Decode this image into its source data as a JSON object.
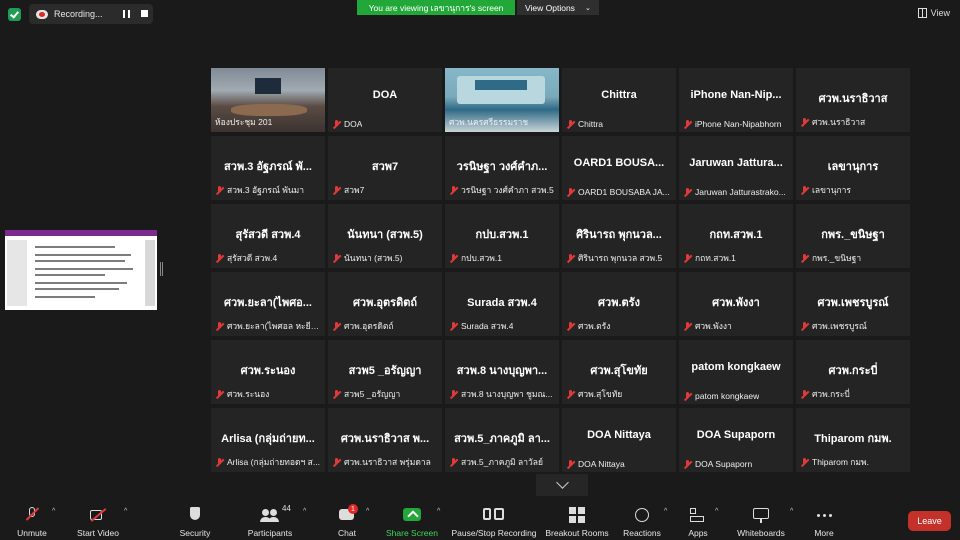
{
  "top_bar": {
    "recording_label": "Recording...",
    "viewing_banner": "You are viewing เลขานุการ's screen",
    "view_options_label": "View Options",
    "view_label": "View"
  },
  "tiles": [
    {
      "name": "",
      "label": "ห้องประชุม 201",
      "video": "room",
      "muted": false,
      "active": true
    },
    {
      "name": "DOA",
      "label": "DOA",
      "muted": true
    },
    {
      "name": "",
      "label": "ศวพ.นครศรีธรรมราช",
      "video": "hall",
      "muted": false
    },
    {
      "name": "Chittra",
      "label": "Chittra",
      "muted": true
    },
    {
      "name": "iPhone  Nan-Nip...",
      "label": "iPhone Nan-Nipabhorn",
      "muted": true
    },
    {
      "name": "ศวพ.นราธิวาส",
      "label": "ศวพ.นราธิวาส",
      "muted": true
    },
    {
      "name": "สวพ.3 อัฐภรณ์ พั...",
      "label": "สวพ.3 อัฐภรณ์ พันมา",
      "muted": true
    },
    {
      "name": "สวพ7",
      "label": "สวพ7",
      "muted": true
    },
    {
      "name": "วรนิษฐา วงศ์คำภ...",
      "label": "วรนิษฐา วงศ์คำภา สวพ.5",
      "muted": true
    },
    {
      "name": "OARD1   BOUSA...",
      "label": "OARD1  BOUSABA JA...",
      "muted": true
    },
    {
      "name": "Jaruwan  Jattura...",
      "label": "Jaruwan Jatturastrako...",
      "muted": true
    },
    {
      "name": "เลขานุการ",
      "label": "เลขานุการ",
      "muted": true
    },
    {
      "name": "สุรัสวดี สวพ.4",
      "label": "สุรัสวดี สวพ.4",
      "muted": true
    },
    {
      "name": "นันทนา (สวพ.5)",
      "label": "นันทนา (สวพ.5)",
      "muted": true
    },
    {
      "name": "กปบ.สวพ.1",
      "label": "กปบ.สวพ.1",
      "muted": true
    },
    {
      "name": "ศิรินารถ  พุกนวล...",
      "label": "ศิรินารถ  พุกนวล  สวพ.5",
      "muted": true
    },
    {
      "name": "กถท.สวพ.1",
      "label": "กถท.สวพ.1",
      "muted": true
    },
    {
      "name": "กพร._ขนิษฐา",
      "label": "กพร._ขนิษฐา",
      "muted": true
    },
    {
      "name": "ศวพ.ยะลา(ไพศอ...",
      "label": "ศวพ.ยะลา(ไพศอล หะยีส...",
      "muted": true
    },
    {
      "name": "ศวพ.อุตรดิตถ์",
      "label": "ศวพ.อุตรดิตถ์",
      "muted": true
    },
    {
      "name": "Surada สวพ.4",
      "label": "Surada สวพ.4",
      "muted": true
    },
    {
      "name": "ศวพ.ตรัง",
      "label": "ศวพ.ตรัง",
      "muted": true
    },
    {
      "name": "ศวพ.พังงา",
      "label": "ศวพ.พังงา",
      "muted": true
    },
    {
      "name": "ศวพ.เพชรบูรณ์",
      "label": "ศวพ.เพชรบูรณ์",
      "muted": true
    },
    {
      "name": "ศวพ.ระนอง",
      "label": "ศวพ.ระนอง",
      "muted": true
    },
    {
      "name": "สวพ5 _อรัญญา",
      "label": "สวพ5 _อรัญญา",
      "muted": true
    },
    {
      "name": "สวพ.8 นางบุญพา...",
      "label": "สวพ.8 นางบุญพา  ชูมณ...",
      "muted": true
    },
    {
      "name": "ศวพ.สุโขทัย",
      "label": "ศวพ.สุโขทัย",
      "muted": true
    },
    {
      "name": "patom kongkaew",
      "label": "patom kongkaew",
      "muted": true
    },
    {
      "name": "ศวพ.กระบี่",
      "label": "ศวพ.กระบี่",
      "muted": true
    },
    {
      "name": "Arlisa (กลุ่มถ่ายท...",
      "label": "Arlisa (กลุ่มถ่ายทอดฯ ส...",
      "muted": true
    },
    {
      "name": "ศวพ.นราธิวาส พ...",
      "label": "ศวพ.นราธิวาส พรุ่มดาล",
      "muted": true
    },
    {
      "name": "สวพ.5_ภาคภูมิ ลา...",
      "label": "สวพ.5_ภาคภูมิ ลาวัลย์",
      "muted": true
    },
    {
      "name": "DOA Nittaya",
      "label": "DOA Nittaya",
      "muted": true
    },
    {
      "name": "DOA Supaporn",
      "label": "DOA Supaporn",
      "muted": true
    },
    {
      "name": "Thiparom กมพ.",
      "label": "Thiparom กมพ.",
      "muted": true
    }
  ],
  "toolbar": {
    "unmute": "Unmute",
    "start_video": "Start Video",
    "security": "Security",
    "participants": "Participants",
    "participants_count": "44",
    "chat": "Chat",
    "chat_badge": "1",
    "share_screen": "Share Screen",
    "pause_stop_recording": "Pause/Stop Recording",
    "breakout_rooms": "Breakout Rooms",
    "reactions": "Reactions",
    "apps": "Apps",
    "whiteboards": "Whiteboards",
    "more": "More",
    "leave": "Leave"
  },
  "colors": {
    "banner_green": "#22a838",
    "leave_red": "#c4312b",
    "active_speaker": "#d6e83a",
    "muted_red": "#e03a3a"
  }
}
